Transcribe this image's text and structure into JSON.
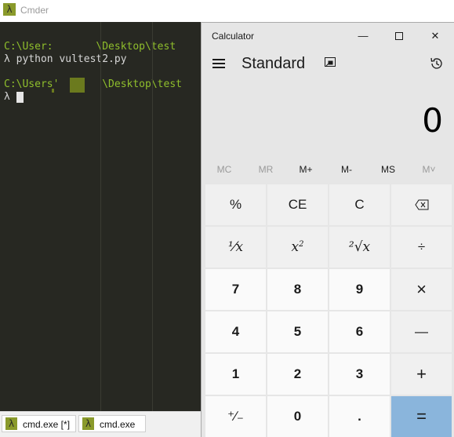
{
  "cmder": {
    "title": "Cmder",
    "logo_glyph": "λ",
    "console": {
      "line1": "C:\\User:       \\Desktop\\test",
      "line2_prompt": "λ",
      "line2_cmd": " python vultest2.py",
      "line3": "C:\\Users'       \\Desktop\\test",
      "line4_prompt": "λ"
    },
    "tabs": [
      {
        "label": "cmd.exe [*]",
        "icon": "λ"
      },
      {
        "label": "cmd.exe",
        "icon": "λ"
      }
    ]
  },
  "calculator": {
    "window_title": "Calculator",
    "mode": "Standard",
    "display_value": "0",
    "window_controls": {
      "minimize": "—",
      "close": "✕"
    },
    "memory": [
      "MC",
      "MR",
      "M+",
      "M-",
      "MS",
      "M˅"
    ],
    "keys": {
      "percent": "%",
      "ce": "CE",
      "c": "C",
      "backspace": "⌫",
      "reciprocal": "⅟x",
      "square_base": "x",
      "square_exp": "2",
      "sqrt": "²√x",
      "divide": "÷",
      "seven": "7",
      "eight": "8",
      "nine": "9",
      "multiply": "×",
      "four": "4",
      "five": "5",
      "six": "6",
      "minus": "—",
      "one": "1",
      "two": "2",
      "three": "3",
      "plus": "+",
      "negate": "⁺∕₋",
      "zero": "0",
      "decimal": ".",
      "equals": "="
    }
  },
  "colors": {
    "console_bg": "#272822",
    "path_green": "#8fbe2c",
    "equals_blue": "#8ab5dc",
    "calc_bg": "#e6e6e6"
  }
}
